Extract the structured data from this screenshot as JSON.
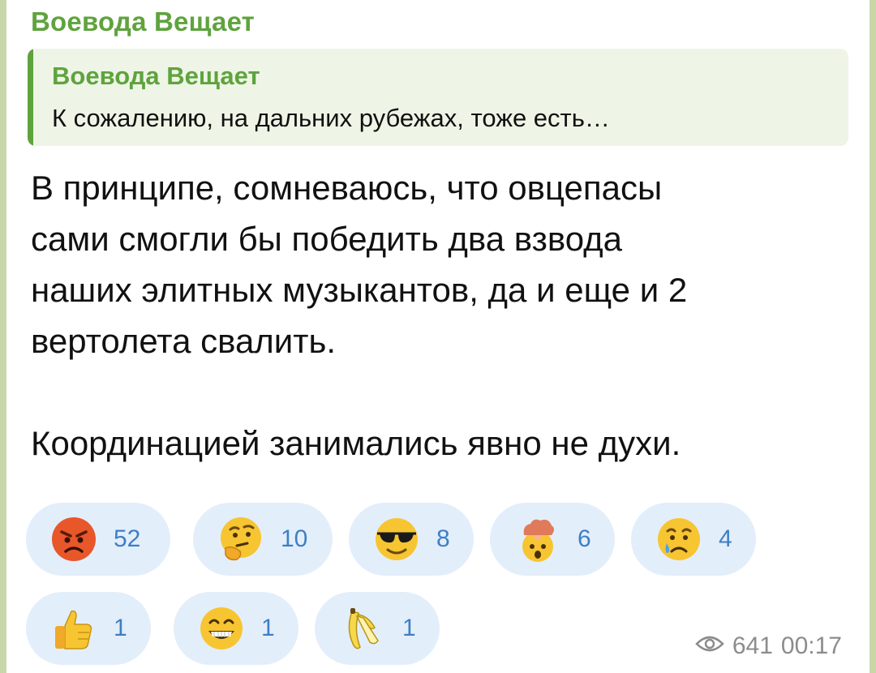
{
  "message": {
    "sender": "Воевода Вещает",
    "reply": {
      "sender": "Воевода Вещает",
      "text": "К сожалению, на дальних рубежах, тоже есть…"
    },
    "body": {
      "line1": "В принципе, сомневаюсь, что овцепасы",
      "line2": "сами смогли бы победить два взвода",
      "line3": "наших элитных музыкантов, да и еще и 2",
      "line4": "вертолета свалить.",
      "line5": "Координацией занимались явно не духи."
    },
    "reactions": [
      {
        "icon": "angry-face-icon",
        "count": "52"
      },
      {
        "icon": "thinking-face-icon",
        "count": "10"
      },
      {
        "icon": "sunglasses-face-icon",
        "count": "8"
      },
      {
        "icon": "exploding-head-icon",
        "count": "6"
      },
      {
        "icon": "crying-face-icon",
        "count": "4"
      },
      {
        "icon": "thumbs-up-icon",
        "count": "1"
      },
      {
        "icon": "grinning-face-icon",
        "count": "1"
      },
      {
        "icon": "banana-icon",
        "count": "1"
      }
    ],
    "meta": {
      "views": "641",
      "time": "00:17"
    }
  },
  "colors": {
    "accent": "#5fa33e",
    "reaction_bg": "#e3eefb",
    "reaction_text": "#3d7fc4",
    "meta_text": "#8c8c8c"
  }
}
